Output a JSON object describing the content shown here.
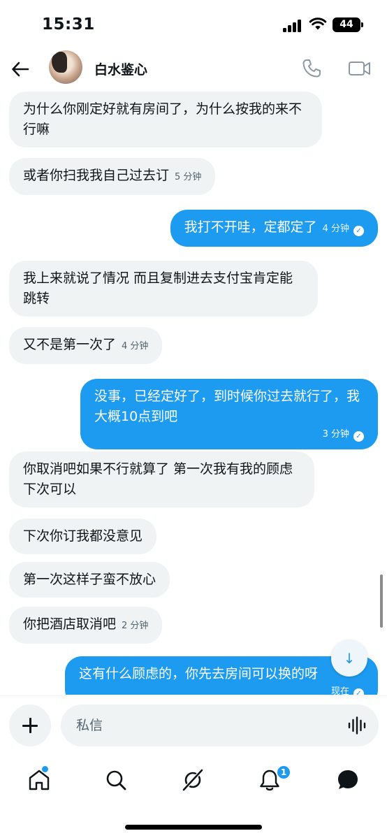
{
  "status_bar": {
    "time": "15:31",
    "battery": "44"
  },
  "header": {
    "contact_name": "白水鉴心"
  },
  "messages": [
    {
      "dir": "in",
      "text": "为什么你刚定好就有房间了，为什么按我的来不行嘛",
      "time": ""
    },
    {
      "dir": "in",
      "text": "或者你扫我我自己过去订",
      "time": "5 分钟"
    },
    {
      "dir": "out",
      "text": "我打不开哇，定都定了",
      "time": "4 分钟"
    },
    {
      "dir": "in",
      "text": "我上来就说了情况  而且复制进去支付宝肯定能跳转",
      "time": ""
    },
    {
      "dir": "in",
      "text": "又不是第一次了",
      "time": "4 分钟"
    },
    {
      "dir": "out",
      "text": "没事，已经定好了，到时候你过去就行了，我大概10点到吧",
      "time": "3 分钟"
    },
    {
      "dir": "in",
      "text": "你取消吧如果不行就算了 第一次我有我的顾虑下次可以",
      "time": ""
    },
    {
      "dir": "in",
      "text": "下次你订我都没意见",
      "time": ""
    },
    {
      "dir": "in",
      "text": "第一次这样子蛮不放心",
      "time": ""
    },
    {
      "dir": "in",
      "text": "你把酒店取消吧",
      "time": "2 分钟"
    },
    {
      "dir": "out",
      "text": "这有什么顾虑的，你先去房间可以换的呀",
      "time": "现在"
    }
  ],
  "composer": {
    "placeholder": "私信"
  },
  "tabbar": {
    "notifications_badge": "1"
  },
  "colors": {
    "accent": "#1d9bf0",
    "incoming_bubble": "#eff3f4",
    "text": "#0f1419"
  },
  "icons": [
    "back-arrow-icon",
    "phone-icon",
    "video-icon",
    "scroll-down-icon",
    "plus-icon",
    "voice-icon",
    "home-icon",
    "search-icon",
    "grok-icon",
    "bell-icon",
    "messages-icon"
  ]
}
